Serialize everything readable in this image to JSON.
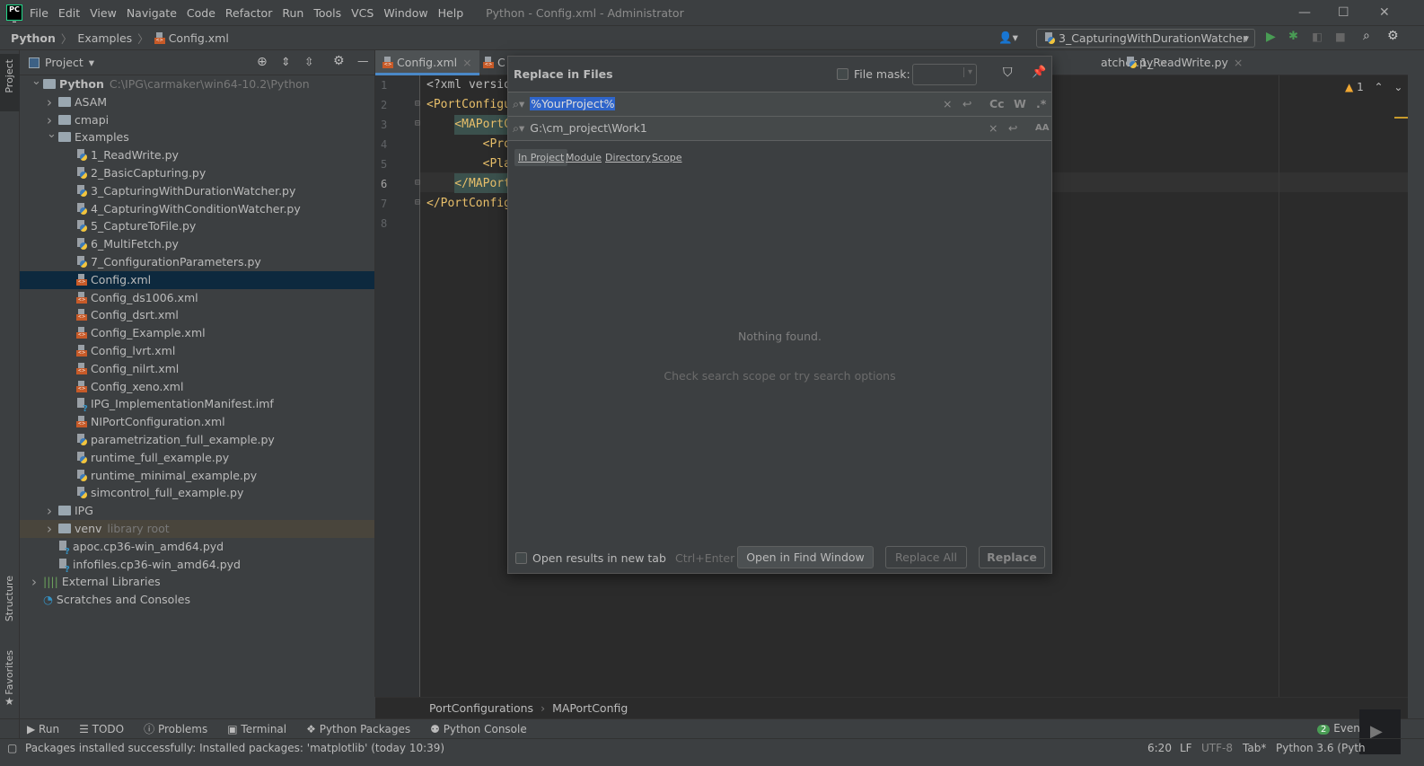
{
  "app": {
    "logo": "PC",
    "window_title": "Python - Config.xml - Administrator"
  },
  "menu": [
    "File",
    "Edit",
    "View",
    "Navigate",
    "Code",
    "Refactor",
    "Run",
    "Tools",
    "VCS",
    "Window",
    "Help"
  ],
  "breadcrumb": {
    "items": [
      "Python",
      "Examples",
      "Config.xml"
    ]
  },
  "run_config": {
    "label": "3_CapturingWithDurationWatcher"
  },
  "project_panel": {
    "title": "Project",
    "tree": [
      {
        "level": 0,
        "type": "folder",
        "label": "Python",
        "bold": true,
        "hint": "C:\\IPG\\carmaker\\win64-10.2\\Python",
        "arrow": "open"
      },
      {
        "level": 1,
        "type": "folder",
        "label": "ASAM",
        "arrow": "closed"
      },
      {
        "level": 1,
        "type": "folder",
        "label": "cmapi",
        "arrow": "closed"
      },
      {
        "level": 1,
        "type": "folder",
        "label": "Examples",
        "arrow": "open"
      },
      {
        "level": 2,
        "type": "py",
        "label": "1_ReadWrite.py"
      },
      {
        "level": 2,
        "type": "py",
        "label": "2_BasicCapturing.py"
      },
      {
        "level": 2,
        "type": "py",
        "label": "3_CapturingWithDurationWatcher.py"
      },
      {
        "level": 2,
        "type": "py",
        "label": "4_CapturingWithConditionWatcher.py"
      },
      {
        "level": 2,
        "type": "py",
        "label": "5_CaptureToFile.py"
      },
      {
        "level": 2,
        "type": "py",
        "label": "6_MultiFetch.py"
      },
      {
        "level": 2,
        "type": "py",
        "label": "7_ConfigurationParameters.py"
      },
      {
        "level": 2,
        "type": "xml",
        "label": "Config.xml",
        "selected": true
      },
      {
        "level": 2,
        "type": "xml",
        "label": "Config_ds1006.xml"
      },
      {
        "level": 2,
        "type": "xml",
        "label": "Config_dsrt.xml"
      },
      {
        "level": 2,
        "type": "xml",
        "label": "Config_Example.xml"
      },
      {
        "level": 2,
        "type": "xml",
        "label": "Config_lvrt.xml"
      },
      {
        "level": 2,
        "type": "xml",
        "label": "Config_nilrt.xml"
      },
      {
        "level": 2,
        "type": "xml",
        "label": "Config_xeno.xml"
      },
      {
        "level": 2,
        "type": "unk",
        "label": "IPG_ImplementationManifest.imf"
      },
      {
        "level": 2,
        "type": "xml",
        "label": "NIPortConfiguration.xml"
      },
      {
        "level": 2,
        "type": "py",
        "label": "parametrization_full_example.py"
      },
      {
        "level": 2,
        "type": "py",
        "label": "runtime_full_example.py"
      },
      {
        "level": 2,
        "type": "py",
        "label": "runtime_minimal_example.py"
      },
      {
        "level": 2,
        "type": "py",
        "label": "simcontrol_full_example.py"
      },
      {
        "level": 1,
        "type": "folder",
        "label": "IPG",
        "arrow": "closed"
      },
      {
        "level": 1,
        "type": "folder",
        "label": "venv",
        "hint": "library root",
        "arrow": "closed",
        "library": true
      },
      {
        "level": 1,
        "type": "unk",
        "label": "apoc.cp36-win_amd64.pyd"
      },
      {
        "level": 1,
        "type": "unk",
        "label": "infofiles.cp36-win_amd64.pyd"
      },
      {
        "level": 0,
        "type": "lib",
        "label": "External Libraries",
        "arrow": "closed"
      },
      {
        "level": 0,
        "type": "scratch",
        "label": "Scratches and Consoles"
      }
    ]
  },
  "side_stripe": {
    "project": "Project",
    "structure": "Structure",
    "favorites": "Favorites"
  },
  "editor": {
    "tabs": [
      {
        "label": "Config.xml",
        "active": true
      },
      {
        "label": "C"
      },
      {
        "label": "atcher.py"
      },
      {
        "label": "1_ReadWrite.py"
      }
    ],
    "lines": [
      "1",
      "2",
      "3",
      "4",
      "5",
      "6",
      "7",
      "8"
    ],
    "code": [
      "<?xml versio",
      "<PortConfigu",
      "    <MAPortC",
      "        <Pro",
      "        <Pla",
      "    </MAPort",
      "</PortConfig",
      ""
    ],
    "warnings": "1",
    "breadcrumb": [
      "PortConfigurations",
      "MAPortConfig"
    ]
  },
  "dialog": {
    "title": "Replace in Files",
    "file_mask_label": "File mask:",
    "file_mask_value": "",
    "search_value": "%YourProject%",
    "replace_value": "G:\\cm_project\\Work1",
    "options": {
      "case": "Cc",
      "words": "W",
      "regex": ".*",
      "preserve_case": "AA"
    },
    "scopes": [
      "In Project",
      "Module",
      "Directory",
      "Scope"
    ],
    "active_scope": "In Project",
    "empty_title": "Nothing found.",
    "empty_hint": "Check search scope or try search options",
    "open_new_tab": "Open results in new tab",
    "shortcut": "Ctrl+Enter",
    "buttons": {
      "open_find": "Open in Find Window",
      "replace_all": "Replace All",
      "replace": "Replace"
    }
  },
  "tool_windows": [
    "Run",
    "TODO",
    "Problems",
    "Terminal",
    "Python Packages",
    "Python Console"
  ],
  "event_log": {
    "count": "2",
    "label": "Event"
  },
  "status": {
    "message": "Packages installed successfully: Installed packages: 'matplotlib' (today 10:39)",
    "position": "6:20",
    "line_sep": "LF",
    "encoding": "UTF-8",
    "indent": "Tab*",
    "interpreter": "Python 3.6 (Pyth"
  },
  "colors": {
    "accent": "#4a88c7",
    "selection": "#2f65ca",
    "tree_selected": "#0d293e",
    "run_green": "#499c54",
    "warning": "#f0a732"
  }
}
